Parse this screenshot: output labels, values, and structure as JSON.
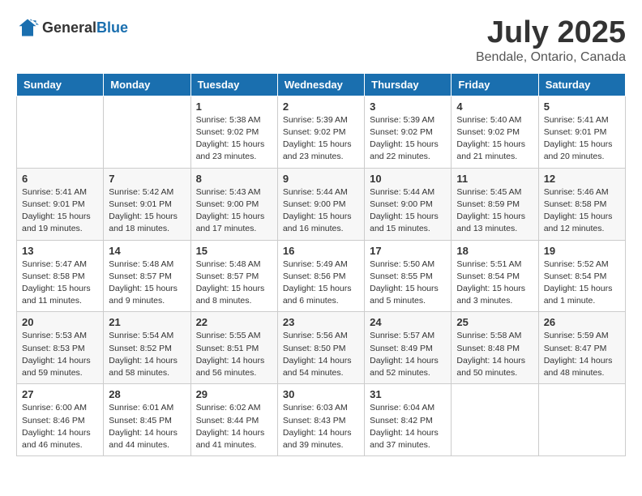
{
  "header": {
    "logo_general": "General",
    "logo_blue": "Blue",
    "title": "July 2025",
    "subtitle": "Bendale, Ontario, Canada"
  },
  "days_of_week": [
    "Sunday",
    "Monday",
    "Tuesday",
    "Wednesday",
    "Thursday",
    "Friday",
    "Saturday"
  ],
  "weeks": [
    [
      {
        "day": "",
        "info": ""
      },
      {
        "day": "",
        "info": ""
      },
      {
        "day": "1",
        "info": "Sunrise: 5:38 AM\nSunset: 9:02 PM\nDaylight: 15 hours\nand 23 minutes."
      },
      {
        "day": "2",
        "info": "Sunrise: 5:39 AM\nSunset: 9:02 PM\nDaylight: 15 hours\nand 23 minutes."
      },
      {
        "day": "3",
        "info": "Sunrise: 5:39 AM\nSunset: 9:02 PM\nDaylight: 15 hours\nand 22 minutes."
      },
      {
        "day": "4",
        "info": "Sunrise: 5:40 AM\nSunset: 9:02 PM\nDaylight: 15 hours\nand 21 minutes."
      },
      {
        "day": "5",
        "info": "Sunrise: 5:41 AM\nSunset: 9:01 PM\nDaylight: 15 hours\nand 20 minutes."
      }
    ],
    [
      {
        "day": "6",
        "info": "Sunrise: 5:41 AM\nSunset: 9:01 PM\nDaylight: 15 hours\nand 19 minutes."
      },
      {
        "day": "7",
        "info": "Sunrise: 5:42 AM\nSunset: 9:01 PM\nDaylight: 15 hours\nand 18 minutes."
      },
      {
        "day": "8",
        "info": "Sunrise: 5:43 AM\nSunset: 9:00 PM\nDaylight: 15 hours\nand 17 minutes."
      },
      {
        "day": "9",
        "info": "Sunrise: 5:44 AM\nSunset: 9:00 PM\nDaylight: 15 hours\nand 16 minutes."
      },
      {
        "day": "10",
        "info": "Sunrise: 5:44 AM\nSunset: 9:00 PM\nDaylight: 15 hours\nand 15 minutes."
      },
      {
        "day": "11",
        "info": "Sunrise: 5:45 AM\nSunset: 8:59 PM\nDaylight: 15 hours\nand 13 minutes."
      },
      {
        "day": "12",
        "info": "Sunrise: 5:46 AM\nSunset: 8:58 PM\nDaylight: 15 hours\nand 12 minutes."
      }
    ],
    [
      {
        "day": "13",
        "info": "Sunrise: 5:47 AM\nSunset: 8:58 PM\nDaylight: 15 hours\nand 11 minutes."
      },
      {
        "day": "14",
        "info": "Sunrise: 5:48 AM\nSunset: 8:57 PM\nDaylight: 15 hours\nand 9 minutes."
      },
      {
        "day": "15",
        "info": "Sunrise: 5:48 AM\nSunset: 8:57 PM\nDaylight: 15 hours\nand 8 minutes."
      },
      {
        "day": "16",
        "info": "Sunrise: 5:49 AM\nSunset: 8:56 PM\nDaylight: 15 hours\nand 6 minutes."
      },
      {
        "day": "17",
        "info": "Sunrise: 5:50 AM\nSunset: 8:55 PM\nDaylight: 15 hours\nand 5 minutes."
      },
      {
        "day": "18",
        "info": "Sunrise: 5:51 AM\nSunset: 8:54 PM\nDaylight: 15 hours\nand 3 minutes."
      },
      {
        "day": "19",
        "info": "Sunrise: 5:52 AM\nSunset: 8:54 PM\nDaylight: 15 hours\nand 1 minute."
      }
    ],
    [
      {
        "day": "20",
        "info": "Sunrise: 5:53 AM\nSunset: 8:53 PM\nDaylight: 14 hours\nand 59 minutes."
      },
      {
        "day": "21",
        "info": "Sunrise: 5:54 AM\nSunset: 8:52 PM\nDaylight: 14 hours\nand 58 minutes."
      },
      {
        "day": "22",
        "info": "Sunrise: 5:55 AM\nSunset: 8:51 PM\nDaylight: 14 hours\nand 56 minutes."
      },
      {
        "day": "23",
        "info": "Sunrise: 5:56 AM\nSunset: 8:50 PM\nDaylight: 14 hours\nand 54 minutes."
      },
      {
        "day": "24",
        "info": "Sunrise: 5:57 AM\nSunset: 8:49 PM\nDaylight: 14 hours\nand 52 minutes."
      },
      {
        "day": "25",
        "info": "Sunrise: 5:58 AM\nSunset: 8:48 PM\nDaylight: 14 hours\nand 50 minutes."
      },
      {
        "day": "26",
        "info": "Sunrise: 5:59 AM\nSunset: 8:47 PM\nDaylight: 14 hours\nand 48 minutes."
      }
    ],
    [
      {
        "day": "27",
        "info": "Sunrise: 6:00 AM\nSunset: 8:46 PM\nDaylight: 14 hours\nand 46 minutes."
      },
      {
        "day": "28",
        "info": "Sunrise: 6:01 AM\nSunset: 8:45 PM\nDaylight: 14 hours\nand 44 minutes."
      },
      {
        "day": "29",
        "info": "Sunrise: 6:02 AM\nSunset: 8:44 PM\nDaylight: 14 hours\nand 41 minutes."
      },
      {
        "day": "30",
        "info": "Sunrise: 6:03 AM\nSunset: 8:43 PM\nDaylight: 14 hours\nand 39 minutes."
      },
      {
        "day": "31",
        "info": "Sunrise: 6:04 AM\nSunset: 8:42 PM\nDaylight: 14 hours\nand 37 minutes."
      },
      {
        "day": "",
        "info": ""
      },
      {
        "day": "",
        "info": ""
      }
    ]
  ]
}
